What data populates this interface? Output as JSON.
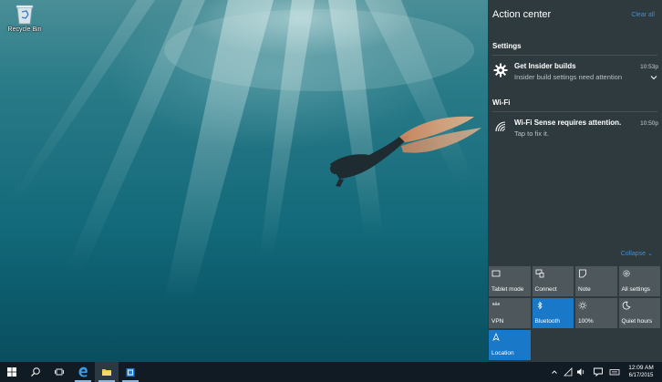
{
  "desktop": {
    "icons": [
      {
        "label": "Recycle Bin",
        "icon": "recycle-bin-icon"
      }
    ]
  },
  "action_center": {
    "title": "Action center",
    "clear_all": "Clear all",
    "groups": [
      {
        "title": "Settings",
        "notifications": [
          {
            "icon": "gear-icon",
            "title": "Get Insider builds",
            "body": "Insider build settings need attention",
            "time": "10:53p"
          }
        ]
      },
      {
        "title": "Wi-Fi",
        "notifications": [
          {
            "icon": "wifi-icon",
            "title": "Wi-Fi Sense requires attention.",
            "body": "Tap to fix it.",
            "time": "10:50p"
          }
        ]
      }
    ],
    "collapse": {
      "label": "Collapse",
      "icon": "chevron-down-icon"
    },
    "quick_actions": [
      {
        "label": "Tablet mode",
        "icon": "tablet-mode-icon",
        "active": false
      },
      {
        "label": "Connect",
        "icon": "connect-icon",
        "active": false
      },
      {
        "label": "Note",
        "icon": "note-icon",
        "active": false
      },
      {
        "label": "All settings",
        "icon": "settings-icon",
        "active": false
      },
      {
        "label": "VPN",
        "icon": "vpn-icon",
        "active": false
      },
      {
        "label": "Bluetooth",
        "icon": "bluetooth-icon",
        "active": true
      },
      {
        "label": "100%",
        "icon": "brightness-icon",
        "active": false
      },
      {
        "label": "Quiet hours",
        "icon": "moon-icon",
        "active": false
      },
      {
        "label": "Location",
        "icon": "location-icon",
        "active": true
      }
    ]
  },
  "taskbar": {
    "buttons": [
      {
        "icon": "windows-start-icon"
      },
      {
        "icon": "search-icon"
      },
      {
        "icon": "task-view-icon"
      },
      {
        "icon": "edge-browser-icon"
      },
      {
        "icon": "file-explorer-icon"
      },
      {
        "icon": "store-icon"
      }
    ],
    "clock": {
      "time": "12:09 AM",
      "date": "6/17/2015"
    }
  },
  "colors": {
    "accent": "#1a78c8",
    "link": "#3a8fd9",
    "action_center_bg": "#2f3a3f",
    "tile_off": "#4d575c",
    "taskbar_bg": "#101b24"
  }
}
